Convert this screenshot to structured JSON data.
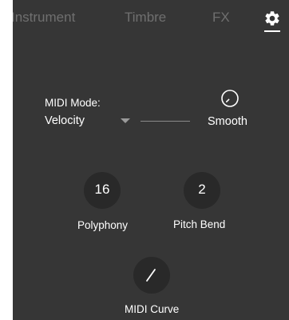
{
  "tabs": {
    "instrument": "Instrument",
    "timbre": "Timbre",
    "fx": "FX",
    "settings_icon": "gear-icon",
    "active": "settings"
  },
  "midi": {
    "mode_label": "MIDI Mode:",
    "mode_value": "Velocity",
    "smooth_label": "Smooth",
    "smooth_icon": "knob-icon"
  },
  "knobs": {
    "polyphony": {
      "value": "16",
      "label": "Polyphony"
    },
    "pitch_bend": {
      "value": "2",
      "label": "Pitch Bend"
    },
    "midi_curve": {
      "label": "MIDI Curve",
      "icon": "curve-slash-icon"
    }
  },
  "colors": {
    "panel": "#363636",
    "knob": "#292929",
    "inactive_tab": "#6f6f6f",
    "text": "#ffffff"
  }
}
